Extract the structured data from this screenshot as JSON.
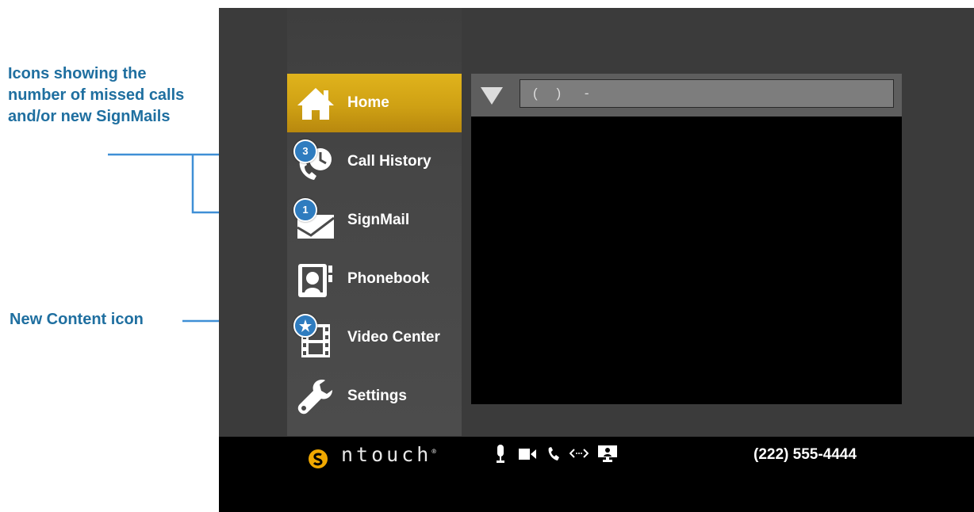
{
  "annotations": {
    "badges_note": "Icons showing the number of missed calls and/or new SignMails",
    "new_content_note": "New Content icon"
  },
  "menu": {
    "items": [
      {
        "label": "Home",
        "icon": "home-icon",
        "active": true
      },
      {
        "label": "Call History",
        "icon": "call-history-icon",
        "badge": "3"
      },
      {
        "label": "SignMail",
        "icon": "signmail-icon",
        "badge": "1"
      },
      {
        "label": "Phonebook",
        "icon": "phonebook-icon"
      },
      {
        "label": "Video Center",
        "icon": "video-center-icon",
        "badge_icon": "star-icon"
      },
      {
        "label": "Settings",
        "icon": "wrench-icon"
      }
    ]
  },
  "dial": {
    "value": "(    )     -",
    "toggle_icon": "triangle-down-icon"
  },
  "status_bar": {
    "brand": "ntouch",
    "brand_mark": "®",
    "icons": [
      "microphone-icon",
      "camera-icon",
      "phone-icon",
      "network-icon",
      "screen-share-icon"
    ],
    "phone_number": "(222) 555-4444"
  },
  "colors": {
    "active": "#d4a515",
    "annotation": "#1f6fa0",
    "arrow": "#3f8fd6",
    "badge": "#2f7cbf",
    "background": "#3b3b3b"
  }
}
